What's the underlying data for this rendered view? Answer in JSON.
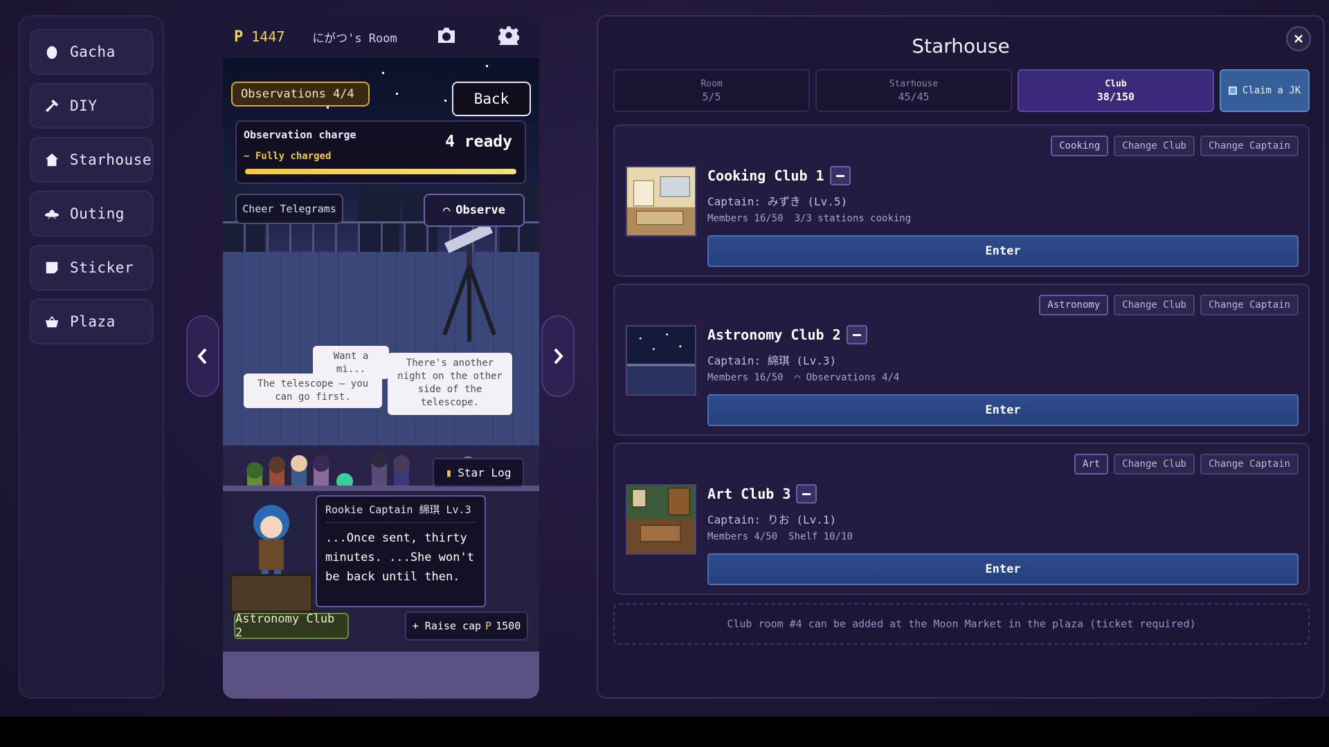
{
  "sidebar": {
    "items": [
      {
        "label": "Gacha",
        "icon": "egg-icon"
      },
      {
        "label": "DIY",
        "icon": "hammer-icon"
      },
      {
        "label": "Starhouse",
        "icon": "house-icon"
      },
      {
        "label": "Outing",
        "icon": "ufo-icon"
      },
      {
        "label": "Sticker",
        "icon": "sticker-icon"
      },
      {
        "label": "Plaza",
        "icon": "basket-icon"
      }
    ]
  },
  "game": {
    "currency_symbol": "P",
    "currency_value": "1447",
    "room_name": "にがつ's Room",
    "observations_badge": "Observations 4/4",
    "back_label": "Back",
    "charge": {
      "title": "Observation charge",
      "ready": "4 ready",
      "status": "Fully charged",
      "fill_fraction": 1.0
    },
    "cheer_label": "Cheer Telegrams",
    "observe_label": "Observe",
    "bubbles": {
      "b1": "Want a mi... sneak... night...",
      "b2": "The telescope — you can go first.",
      "b3": "There's another night on the other side of the telescope."
    },
    "star_log_label": "Star Log",
    "dialog": {
      "speaker": "Rookie Captain 綿琪 Lv.3",
      "text": "...Once sent, thirty minutes. ...She won't be back until then."
    },
    "club_tag": "Astronomy Club 2",
    "raise_cap_label": "+ Raise cap",
    "raise_cap_cost": "1500"
  },
  "panel": {
    "title": "Starhouse",
    "tabs": [
      {
        "label": "Room",
        "value": "5/5"
      },
      {
        "label": "Starhouse",
        "value": "45/45"
      },
      {
        "label": "Club",
        "value": "38/150"
      }
    ],
    "claim_label": "Claim a JK",
    "clubs": [
      {
        "type": "Cooking",
        "change_club": "Change Club",
        "change_captain": "Change Captain",
        "name": "Cooking Club 1",
        "captain": "Captain: みずき (Lv.5)",
        "members": "Members 16/50",
        "extra": "3/3 stations cooking",
        "enter": "Enter"
      },
      {
        "type": "Astronomy",
        "change_club": "Change Club",
        "change_captain": "Change Captain",
        "name": "Astronomy Club 2",
        "captain": "Captain: 綿琪 (Lv.3)",
        "members": "Members 16/50",
        "extra": "Observations 4/4",
        "enter": "Enter"
      },
      {
        "type": "Art",
        "change_club": "Change Club",
        "change_captain": "Change Captain",
        "name": "Art Club 3",
        "captain": "Captain: りお (Lv.1)",
        "members": "Members 4/50",
        "extra": "Shelf 10/10",
        "enter": "Enter"
      }
    ],
    "add_note": "Club room #4 can be added at the Moon Market in the plaza (ticket required)"
  },
  "colors": {
    "accent": "#3b2a7a",
    "enter_button": "#2f4a8c",
    "gold": "#f2d35b"
  }
}
